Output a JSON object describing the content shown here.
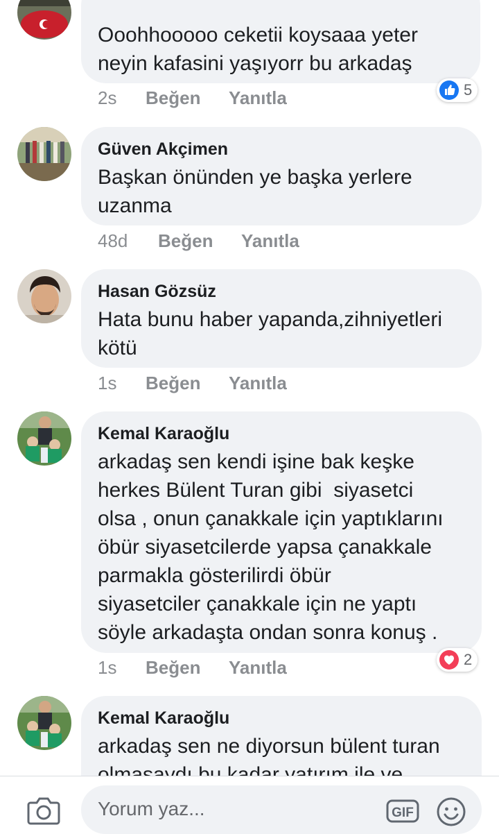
{
  "comments": [
    {
      "name": "",
      "text": "Ooohhooooo ceketii koysaaa yeter\nneyin kafasini yaşıyorr bu arkadaş",
      "time": "2s",
      "like_label": "Beğen",
      "reply_label": "Yanıtla",
      "reaction": {
        "icon": "like-thumb-icon",
        "count": "5"
      }
    },
    {
      "name": "Güven Akçimen",
      "text": "Başkan önünden ye başka yerlere\nuzanma",
      "time": "48d",
      "like_label": "Beğen",
      "reply_label": "Yanıtla"
    },
    {
      "name": "Hasan Gözsüz",
      "text": "Hata bunu haber yapanda,zihniyetleri\nkötü",
      "time": "1s",
      "like_label": "Beğen",
      "reply_label": "Yanıtla"
    },
    {
      "name": "Kemal Karaoğlu",
      "text": "arkadaş sen kendi işine bak keşke\nherkes Bülent Turan gibi  siyasetci\nolsa , onun çanakkale için yaptıklarını\nöbür siyasetcilerde yapsa çanakkale\nparmakla gösterilirdi öbür\nsiyasetciler çanakkale için ne yaptı\nsöyle arkadaşta ondan sonra konuş .",
      "time": "1s",
      "like_label": "Beğen",
      "reply_label": "Yanıtla",
      "reaction": {
        "icon": "love-heart-icon",
        "count": "2"
      }
    },
    {
      "name": "Kemal Karaoğlu",
      "text": "arkadaş sen ne diyorsun bülent turan\nolmasaydı bu kadar yatırım ile ve"
    }
  ],
  "composer": {
    "placeholder": "Yorum yaz...",
    "gif_label": "GIF"
  },
  "colors": {
    "like_blue": "#1877f2",
    "love_red": "#f33e58",
    "bubble_bg": "#f0f2f5",
    "meta_gray": "#8a8d91"
  }
}
